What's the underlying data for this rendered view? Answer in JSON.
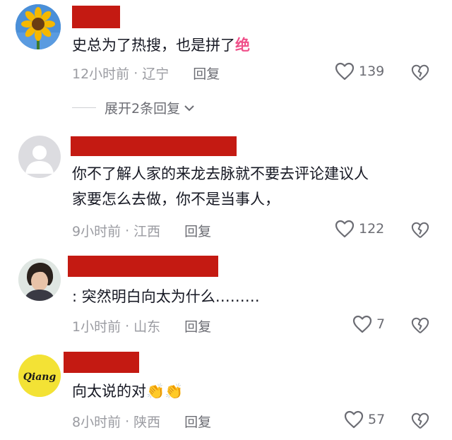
{
  "comments": [
    {
      "text": "史总为了热搜，也是拼了",
      "emoji": "绝",
      "time": "12小时前",
      "location": "辽宁",
      "reply": "回复",
      "likes": "139",
      "avatar": "sunflower-avatar",
      "expand": "展开2条回复"
    },
    {
      "text": "你不了解人家的来龙去脉就不要去评论建议人\n家要怎么去做，你不是当事人，",
      "time": "9小时前",
      "location": "江西",
      "reply": "回复",
      "likes": "122",
      "avatar": "default-avatar"
    },
    {
      "text": ": 突然明白向太为什么………",
      "time": "1小时前",
      "location": "山东",
      "reply": "回复",
      "likes": "7",
      "avatar": "photo-avatar"
    },
    {
      "text": "向太说的对",
      "emoji": "👏👏",
      "time": "8小时前",
      "location": "陕西",
      "reply": "回复",
      "likes": "57",
      "avatar": "qiang-logo-avatar",
      "avatar_text": "Qiang"
    }
  ],
  "separator": "·",
  "colors": {
    "redaction": "#c41a12",
    "meta": "#9a9ba1",
    "text": "#161823",
    "accent_emoji": "#f0508a"
  }
}
